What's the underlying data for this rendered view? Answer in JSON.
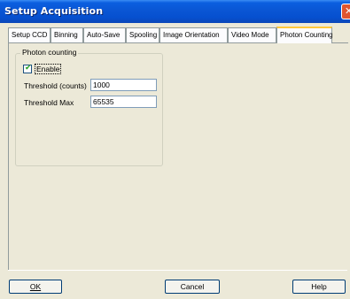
{
  "window": {
    "title": "Setup Acquisition",
    "close_glyph": "✕"
  },
  "tabs": [
    {
      "label": "Setup CCD",
      "active": false
    },
    {
      "label": "Binning",
      "active": false
    },
    {
      "label": "Auto-Save",
      "active": false
    },
    {
      "label": "Spooling",
      "active": false
    },
    {
      "label": "Image Orientation",
      "active": false
    },
    {
      "label": "Video Mode",
      "active": false
    },
    {
      "label": "Photon Counting",
      "active": true
    }
  ],
  "photon_group": {
    "title": "Photon counting",
    "enable": {
      "label": "Enable",
      "checked": true,
      "glyph": "✔"
    },
    "threshold": {
      "label": "Threshold (counts)",
      "value": "1000"
    },
    "threshold_max": {
      "label": "Threshold Max",
      "value": "65535"
    }
  },
  "buttons": {
    "ok": "OK",
    "cancel": "Cancel",
    "help": "Help"
  },
  "colors": {
    "titlebar": "#0a56d4",
    "dialog": "#ece9d8",
    "tab_active_accent": "#ffc83c",
    "close": "#e0552f"
  }
}
